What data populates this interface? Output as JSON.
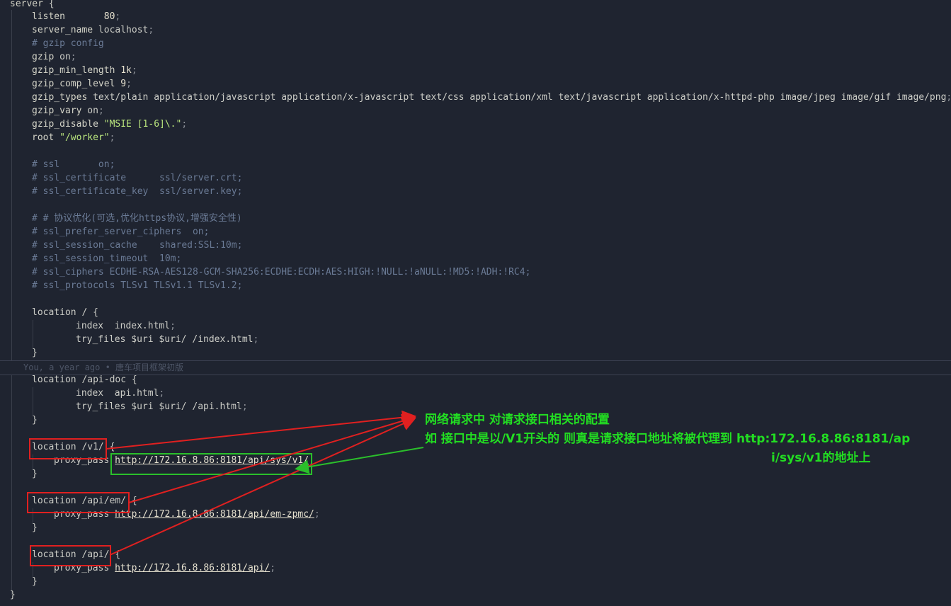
{
  "code": {
    "l0": "server",
    "l0b": " {",
    "listen_kw": "listen",
    "listen_val": "80",
    "server_name_kw": "server_name",
    "server_name_val": "localhost",
    "gzip_comment": "# gzip config",
    "gzip_kw": "gzip",
    "gzip_val": "on",
    "gzip_min_kw": "gzip_min_length",
    "gzip_min_val": "1k",
    "gzip_comp_kw": "gzip_comp_level",
    "gzip_comp_val": "9",
    "gzip_types_kw": "gzip_types",
    "gzip_types_val": "text/plain application/javascript application/x-javascript text/css application/xml text/javascript application/x-httpd-php image/jpeg image/gif image/png",
    "gzip_vary_kw": "gzip_vary",
    "gzip_vary_val": "on",
    "gzip_disable_kw": "gzip_disable",
    "gzip_disable_val": "\"MSIE [1-6]\\.\"",
    "root_kw": "root",
    "root_val": "\"/worker\"",
    "c_ssl": "# ssl       on;",
    "c_ssl_cert": "# ssl_certificate      ssl/server.crt;",
    "c_ssl_key": "# ssl_certificate_key  ssl/server.key;",
    "c_proto": "# # 协议优化(可选,优化https协议,增强安全性)",
    "c_prefer": "# ssl_prefer_server_ciphers  on;",
    "c_cache": "# ssl_session_cache    shared:SSL:10m;",
    "c_timeout": "# ssl_session_timeout  10m;",
    "c_ciphers": "# ssl_ciphers ECDHE-RSA-AES128-GCM-SHA256:ECDHE:ECDH:AES:HIGH:!NULL:!aNULL:!MD5:!ADH:!RC4;",
    "c_protocols": "# ssl_protocols TLSv1 TLSv1.1 TLSv1.2;",
    "loc_root": "location / {",
    "index_kw": "index",
    "index_val": "index.html",
    "try_kw": "try_files",
    "try_val": "$uri $uri/ /index.html",
    "close": "}",
    "loc_apidoc": "location /api-doc {",
    "index2_val": "api.html",
    "try2_val": "$uri $uri/ /api.html",
    "loc_v1": "location /v1/",
    "brace_open": "{",
    "proxy_kw": "proxy_pass",
    "proxy_v1": "http://172.16.8.86:8181/api/sys/v1/",
    "loc_em": "location /api/em/",
    "proxy_em": "http://172.16.8.86:8181/api/em-zpmc/",
    "loc_api": "location /api/",
    "proxy_api": "http://172.16.8.86:8181/api/",
    "final_close": "}"
  },
  "blame": "You, a year ago • 唐车项目框架初版",
  "annotation": {
    "line1": "网络请求中 对请求接口相关的配置",
    "line2": "如 接口中是以/V1开头的 则真是请求接口地址将被代理到 http:172.16.8.86:8181/ap",
    "line3": "i/sys/v1的地址上"
  },
  "colors": {
    "background": "#1f2430",
    "annotation_text": "#22dd22",
    "red_box": "#e02020",
    "green_box": "#2bbf2b",
    "comment": "#6a7a95",
    "string": "#bae67e"
  }
}
